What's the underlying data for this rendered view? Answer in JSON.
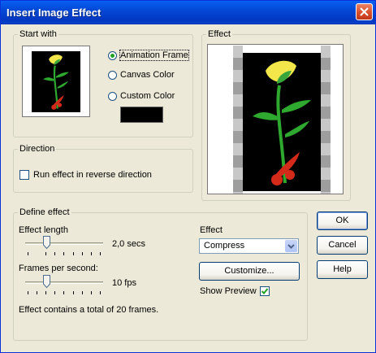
{
  "window": {
    "title": "Insert Image Effect"
  },
  "start_with": {
    "legend": "Start with",
    "options": [
      {
        "label": "Animation Frame",
        "checked": true
      },
      {
        "label": "Canvas Color",
        "checked": false
      },
      {
        "label": "Custom Color",
        "checked": false
      }
    ],
    "custom_color": "#000000"
  },
  "effect_group": {
    "legend": "Effect"
  },
  "direction": {
    "legend": "Direction",
    "reverse_label": "Run effect in reverse direction",
    "reverse_checked": false
  },
  "define_effect": {
    "legend": "Define effect",
    "effect_length": {
      "label": "Effect length",
      "value": "2,0 secs",
      "position": 0.2
    },
    "frames_per_second": {
      "label": "Frames per second:",
      "value": "10 fps",
      "position": 0.2
    },
    "summary": "Effect contains a total of 20 frames.",
    "effect_label": "Effect",
    "effect_select": {
      "value": "Compress"
    },
    "customize_label": "Customize...",
    "show_preview_label": "Show Preview",
    "show_preview_checked": true
  },
  "buttons": {
    "ok": "OK",
    "cancel": "Cancel",
    "help": "Help"
  },
  "colors": {
    "title_bar": "#0a5ff2",
    "dialog": "#ece9d8",
    "leaf_green": "#2ea82e",
    "flower_yellow": "#f2e64a",
    "red": "#d42a1a"
  }
}
